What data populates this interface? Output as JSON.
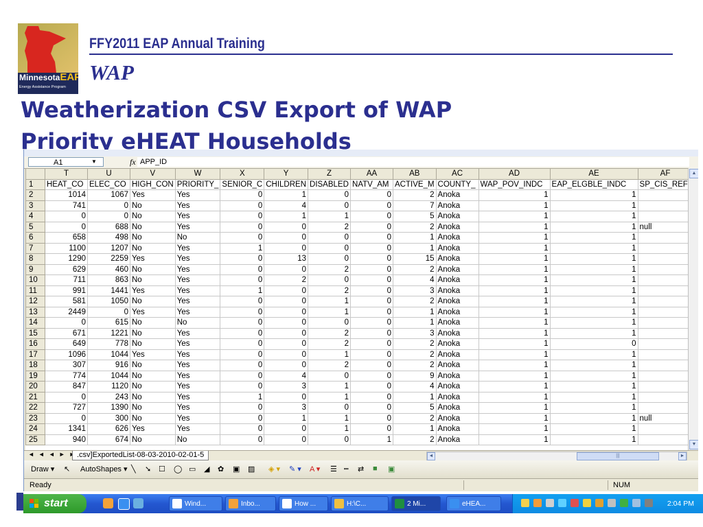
{
  "slide": {
    "training_title": "FFY2011 EAP Annual Training",
    "section": "WAP",
    "title_line1": "Weatherization CSV Export of WAP",
    "title_line2": "Priority eHEAT Households",
    "logo_text_minnesota": "Minnesota",
    "logo_text_eap": "EAP",
    "logo_tagline": "Energy Assistance Program"
  },
  "excel": {
    "name_box": "A1",
    "formula_value": "APP_ID",
    "columns": [
      "T",
      "U",
      "V",
      "W",
      "X",
      "Y",
      "Z",
      "AA",
      "AB",
      "AC",
      "AD",
      "AE",
      "AF"
    ],
    "header_row": [
      "HEAT_CO",
      "ELEC_CO",
      "HIGH_CON",
      "PRIORITY_",
      "SENIOR_C",
      "CHILDREN",
      "DISABLED",
      "NATV_AM",
      "ACTIVE_M",
      "COUNTY_",
      "WAP_POV_INDC",
      "EAP_ELGBLE_INDC",
      "SP_CIS_REF"
    ],
    "rows": [
      [
        "2",
        "1014",
        "1067",
        "Yes",
        "Yes",
        "0",
        "1",
        "0",
        "0",
        "2",
        "Anoka",
        "1",
        "1",
        ""
      ],
      [
        "3",
        "741",
        "0",
        "No",
        "Yes",
        "0",
        "4",
        "0",
        "0",
        "7",
        "Anoka",
        "1",
        "1",
        ""
      ],
      [
        "4",
        "0",
        "0",
        "No",
        "Yes",
        "0",
        "1",
        "1",
        "0",
        "5",
        "Anoka",
        "1",
        "1",
        ""
      ],
      [
        "5",
        "0",
        "688",
        "No",
        "Yes",
        "0",
        "0",
        "2",
        "0",
        "2",
        "Anoka",
        "1",
        "1",
        "null"
      ],
      [
        "6",
        "658",
        "498",
        "No",
        "No",
        "0",
        "0",
        "0",
        "0",
        "1",
        "Anoka",
        "1",
        "1",
        ""
      ],
      [
        "7",
        "1100",
        "1207",
        "No",
        "Yes",
        "1",
        "0",
        "0",
        "0",
        "1",
        "Anoka",
        "1",
        "1",
        ""
      ],
      [
        "8",
        "1290",
        "2259",
        "Yes",
        "Yes",
        "0",
        "13",
        "0",
        "0",
        "15",
        "Anoka",
        "1",
        "1",
        ""
      ],
      [
        "9",
        "629",
        "460",
        "No",
        "Yes",
        "0",
        "0",
        "2",
        "0",
        "2",
        "Anoka",
        "1",
        "1",
        ""
      ],
      [
        "10",
        "711",
        "863",
        "No",
        "Yes",
        "0",
        "2",
        "0",
        "0",
        "4",
        "Anoka",
        "1",
        "1",
        ""
      ],
      [
        "11",
        "991",
        "1441",
        "Yes",
        "Yes",
        "1",
        "0",
        "2",
        "0",
        "3",
        "Anoka",
        "1",
        "1",
        ""
      ],
      [
        "12",
        "581",
        "1050",
        "No",
        "Yes",
        "0",
        "0",
        "1",
        "0",
        "2",
        "Anoka",
        "1",
        "1",
        ""
      ],
      [
        "13",
        "2449",
        "0",
        "Yes",
        "Yes",
        "0",
        "0",
        "1",
        "0",
        "1",
        "Anoka",
        "1",
        "1",
        ""
      ],
      [
        "14",
        "0",
        "615",
        "No",
        "No",
        "0",
        "0",
        "0",
        "0",
        "1",
        "Anoka",
        "1",
        "1",
        ""
      ],
      [
        "15",
        "671",
        "1221",
        "No",
        "Yes",
        "0",
        "0",
        "2",
        "0",
        "3",
        "Anoka",
        "1",
        "1",
        ""
      ],
      [
        "16",
        "649",
        "778",
        "No",
        "Yes",
        "0",
        "0",
        "2",
        "0",
        "2",
        "Anoka",
        "1",
        "0",
        ""
      ],
      [
        "17",
        "1096",
        "1044",
        "Yes",
        "Yes",
        "0",
        "0",
        "1",
        "0",
        "2",
        "Anoka",
        "1",
        "1",
        ""
      ],
      [
        "18",
        "307",
        "916",
        "No",
        "Yes",
        "0",
        "0",
        "2",
        "0",
        "2",
        "Anoka",
        "1",
        "1",
        ""
      ],
      [
        "19",
        "774",
        "1044",
        "No",
        "Yes",
        "0",
        "4",
        "0",
        "0",
        "9",
        "Anoka",
        "1",
        "1",
        ""
      ],
      [
        "20",
        "847",
        "1120",
        "No",
        "Yes",
        "0",
        "3",
        "1",
        "0",
        "4",
        "Anoka",
        "1",
        "1",
        ""
      ],
      [
        "21",
        "0",
        "243",
        "No",
        "Yes",
        "1",
        "0",
        "1",
        "0",
        "1",
        "Anoka",
        "1",
        "1",
        ""
      ],
      [
        "22",
        "727",
        "1390",
        "No",
        "Yes",
        "0",
        "3",
        "0",
        "0",
        "5",
        "Anoka",
        "1",
        "1",
        ""
      ],
      [
        "23",
        "0",
        "300",
        "No",
        "Yes",
        "0",
        "1",
        "1",
        "0",
        "2",
        "Anoka",
        "1",
        "1",
        "null"
      ],
      [
        "24",
        "1341",
        "626",
        "Yes",
        "Yes",
        "0",
        "0",
        "1",
        "0",
        "1",
        "Anoka",
        "1",
        "1",
        ""
      ],
      [
        "25",
        "940",
        "674",
        "No",
        "No",
        "0",
        "0",
        "0",
        "1",
        "2",
        "Anoka",
        "1",
        "1",
        ""
      ]
    ],
    "sheet_tab": ".csv]ExportedList-08-03-2010-02-01-5",
    "draw_label": "Draw",
    "autoshapes_label": "AutoShapes",
    "status_ready": "Ready",
    "status_num": "NUM"
  },
  "taskbar": {
    "start_label": "start",
    "tasks": [
      "Wind...",
      "Inbo...",
      "How ...",
      "H:\\C...",
      "2 Mi...",
      "eHEA..."
    ],
    "clock": "2:04 PM"
  }
}
